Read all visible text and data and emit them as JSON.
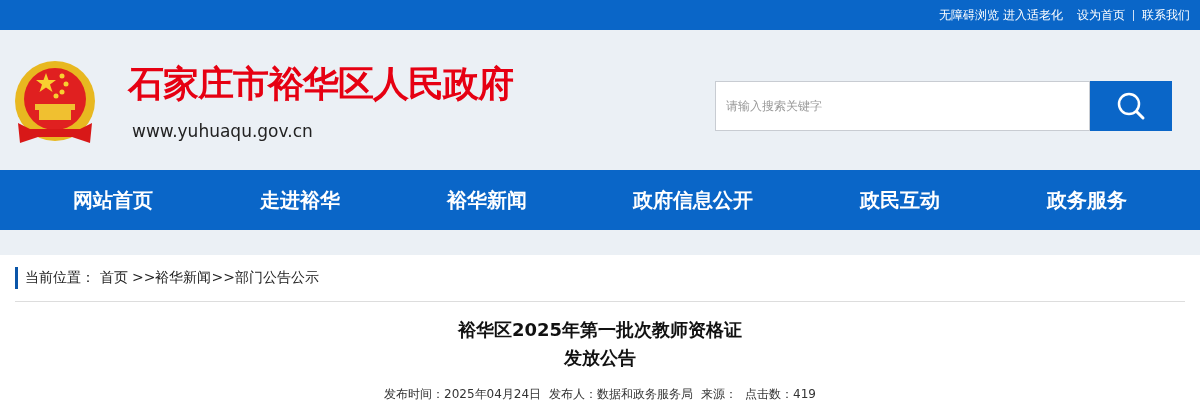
{
  "top_bar": {
    "links": [
      "无障碍浏览",
      "进入适老化",
      "设为首页",
      "联系我们"
    ]
  },
  "header": {
    "site_title": "石家庄市裕华区人民政府",
    "url": "www.yuhuaqu.gov.cn",
    "search": {
      "placeholder": "请输入搜索关键字"
    }
  },
  "nav": {
    "items": [
      {
        "label": "网站首页"
      },
      {
        "label": "走进裕华"
      },
      {
        "label": "裕华新闻"
      },
      {
        "label": "政府信息公开"
      },
      {
        "label": "政民互动"
      },
      {
        "label": "政务服务"
      }
    ]
  },
  "breadcrumb": {
    "label": "当前位置：",
    "items": [
      "首页",
      ">>裕华新闻",
      ">>部门公告公示"
    ]
  },
  "article": {
    "title": "裕华区2025年第一批次教师资格证发放公告",
    "meta": [
      "发布时间：2025年04月24日",
      "发布人：数据和政务服务局",
      "来源：",
      "点击数：419"
    ]
  }
}
